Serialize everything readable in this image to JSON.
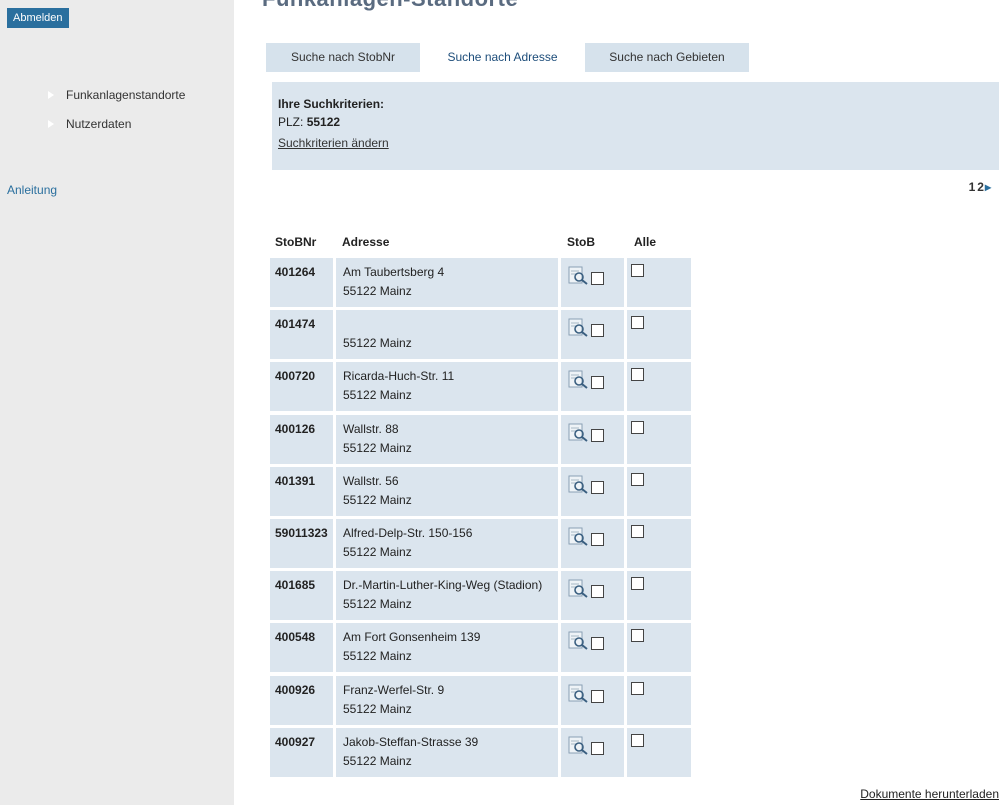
{
  "sidebar": {
    "logout_label": "Abmelden",
    "items": [
      {
        "label": "Funkanlagenstandorte"
      },
      {
        "label": "Nutzerdaten"
      }
    ],
    "help_label": "Anleitung"
  },
  "header": {
    "title": "Funkanlagen-Standorte"
  },
  "tabs": [
    {
      "label": "Suche nach StobNr"
    },
    {
      "label": "Suche nach Adresse"
    },
    {
      "label": "Suche nach Gebieten"
    }
  ],
  "criteria": {
    "heading": "Ihre Suchkriterien:",
    "plz_prefix": "PLZ:",
    "plz_value": "55122",
    "change_label": "Suchkriterien ändern"
  },
  "pager": {
    "page1": "1",
    "page2": "2",
    "next": "▸"
  },
  "table": {
    "headers": {
      "num": "StoBNr",
      "addr": "Adresse",
      "stob": "StoB",
      "all": "Alle"
    },
    "rows": [
      {
        "num": "401264",
        "street": "Am Taubertsberg 4",
        "city": "55122 Mainz"
      },
      {
        "num": "401474",
        "street": "",
        "city": "55122 Mainz"
      },
      {
        "num": "400720",
        "street": "Ricarda-Huch-Str. 11",
        "city": "55122 Mainz"
      },
      {
        "num": "400126",
        "street": "Wallstr. 88",
        "city": "55122 Mainz"
      },
      {
        "num": "401391",
        "street": "Wallstr. 56",
        "city": "55122 Mainz"
      },
      {
        "num": "59011323",
        "street": "Alfred-Delp-Str. 150-156",
        "city": "55122 Mainz"
      },
      {
        "num": "401685",
        "street": "Dr.-Martin-Luther-King-Weg (Stadion)",
        "city": "55122 Mainz"
      },
      {
        "num": "400548",
        "street": "Am Fort Gonsenheim 139",
        "city": "55122 Mainz"
      },
      {
        "num": "400926",
        "street": "Franz-Werfel-Str. 9",
        "city": "55122 Mainz"
      },
      {
        "num": "400927",
        "street": "Jakob-Steffan-Strasse 39",
        "city": "55122 Mainz"
      }
    ]
  },
  "footer": {
    "download_label": "Dokumente herunterladen"
  },
  "colors": {
    "accent": "#2a6f9e",
    "panel": "#dbe5ee",
    "sidebar": "#ebebeb"
  }
}
